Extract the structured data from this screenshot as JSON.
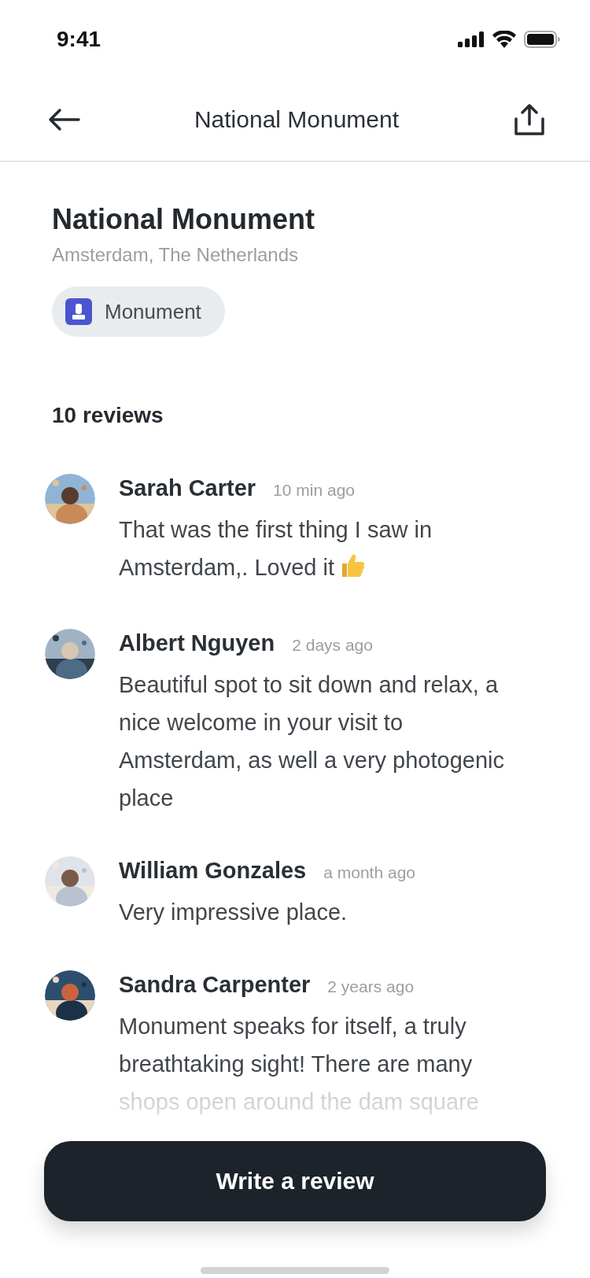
{
  "status_bar": {
    "time": "9:41"
  },
  "nav_bar": {
    "title": "National Monument"
  },
  "place": {
    "name": "National Monument",
    "location": "Amsterdam, The Netherlands",
    "category": "Monument"
  },
  "reviews": {
    "count_label": "10 reviews",
    "items": [
      {
        "author": "Sarah Carter",
        "time": "10 min ago",
        "text": "That was the first thing I saw in Amsterdam,. Loved it",
        "thumbs_up": true
      },
      {
        "author": "Albert Nguyen",
        "time": "2 days ago",
        "text": "Beautiful spot to sit down and relax, a nice welcome in your visit to Amsterdam, as well a very photogenic place",
        "thumbs_up": false
      },
      {
        "author": "William Gonzales",
        "time": "a month ago",
        "text": "Very impressive place.",
        "thumbs_up": false
      },
      {
        "author": "Sandra Carpenter",
        "time": "2 years ago",
        "text": "Monument speaks for itself, a truly breathtaking sight! There are many shops open around the dam square",
        "thumbs_up": false
      }
    ]
  },
  "actions": {
    "write_review": "Write a review"
  }
}
